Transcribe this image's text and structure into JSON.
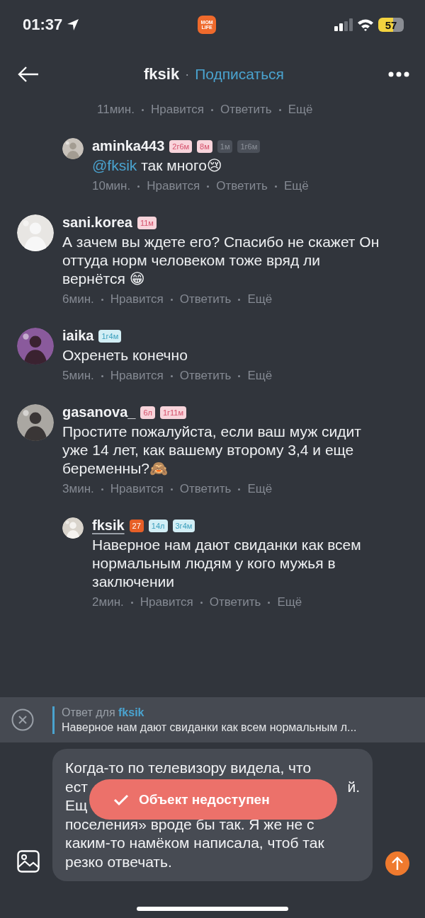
{
  "status_bar": {
    "time": "01:37",
    "app_icon_text": [
      "MOM",
      "LIFE"
    ],
    "battery": "57"
  },
  "header": {
    "title": "fksik",
    "separator": "·",
    "action": "Подписаться"
  },
  "comments": [
    {
      "kind": "meta_only",
      "meta": {
        "time": "11мин.",
        "like": "Нравится",
        "reply": "Ответить",
        "more": "Ещё"
      }
    },
    {
      "kind": "reply",
      "author": "aminka443",
      "is_author": false,
      "badges": [
        {
          "text": "2г6м",
          "kind": "pink"
        },
        {
          "text": "8м",
          "kind": "pink"
        },
        {
          "text": "1м",
          "kind": "grey"
        },
        {
          "text": "1г6м",
          "kind": "grey"
        }
      ],
      "mention": "@fksik",
      "text": "так много😢",
      "meta": {
        "time": "10мин.",
        "like": "Нравится",
        "reply": "Ответить",
        "more": "Ещё"
      }
    },
    {
      "kind": "comment",
      "author": "sani.korea",
      "is_author": false,
      "badges": [
        {
          "text": "11м",
          "kind": "pink"
        }
      ],
      "text": "А зачем вы ждете его? Спасибо не скажет Он оттуда норм человеком тоже вряд ли вернётся 😁",
      "meta": {
        "time": "6мин.",
        "like": "Нравится",
        "reply": "Ответить",
        "more": "Ещё"
      }
    },
    {
      "kind": "comment",
      "author": "iaika",
      "is_author": false,
      "badges": [
        {
          "text": "1г4м",
          "kind": "blue"
        }
      ],
      "text": "Охренеть конечно",
      "meta": {
        "time": "5мин.",
        "like": "Нравится",
        "reply": "Ответить",
        "more": "Ещё"
      }
    },
    {
      "kind": "comment",
      "author": "gasanova_",
      "is_author": false,
      "badges": [
        {
          "text": "6л",
          "kind": "pink"
        },
        {
          "text": "1г11м",
          "kind": "pink"
        }
      ],
      "text": "Простите пожалуйста, если ваш муж сидит уже 14 лет, как вашему второму 3,4 и еще беременны?🙈",
      "meta": {
        "time": "3мин.",
        "like": "Нравится",
        "reply": "Ответить",
        "more": "Ещё"
      }
    },
    {
      "kind": "reply",
      "author": "fksik",
      "is_author": true,
      "badges": [
        {
          "text": "27",
          "kind": "orange"
        },
        {
          "text": "14л",
          "kind": "blue"
        },
        {
          "text": "3г4м",
          "kind": "blue"
        }
      ],
      "text": "Наверное нам дают свиданки как всем нормальным людям у кого мужья в заключении",
      "meta": {
        "time": "2мин.",
        "like": "Нравится",
        "reply": "Ответить",
        "more": "Ещё"
      }
    }
  ],
  "reply_bar": {
    "label": "Ответ для",
    "target": "fksik",
    "quote": "Наверное нам дают свиданки как всем нормальным л..."
  },
  "composer": {
    "lines": [
      [
        "Когда-то по телевизору видела, что"
      ],
      [
        "ест",
        "й."
      ],
      [
        "Ещ"
      ],
      [
        "поселения» вроде бы так. Я же не с"
      ],
      [
        "каким-то намёком написала, чтоб так"
      ],
      [
        "резко отвечать."
      ]
    ]
  },
  "toast": {
    "text": "Объект недоступен"
  }
}
